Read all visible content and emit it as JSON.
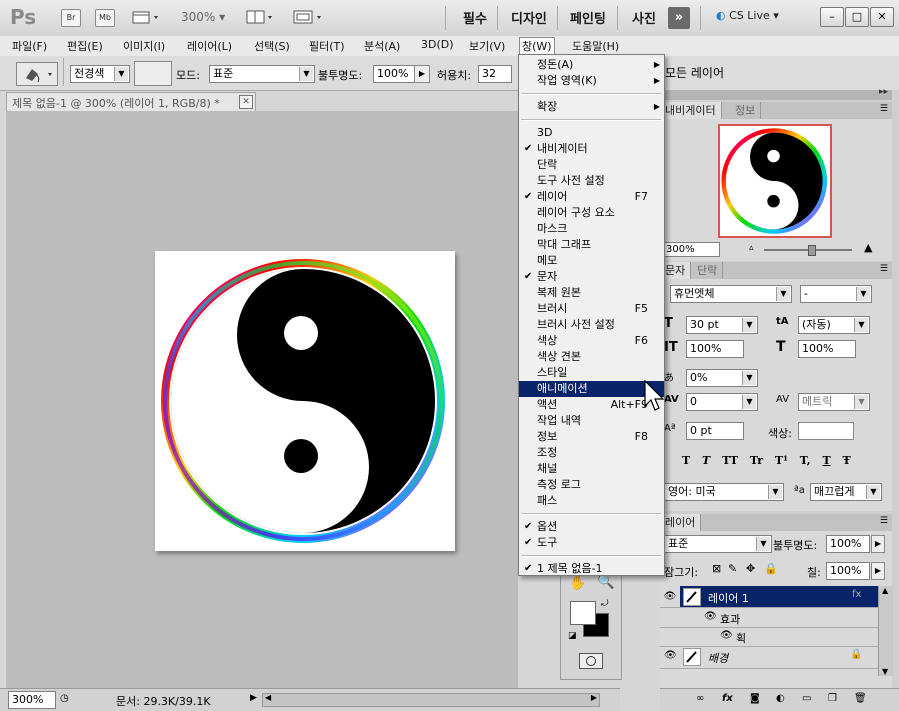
{
  "app": {
    "logo": "Ps",
    "bridge": "Br",
    "mini_bridge": "Mb",
    "zoom_label": "300%",
    "workspaces": [
      "필수",
      "디자인",
      "페인팅",
      "사진"
    ],
    "cs_live": "CS Live"
  },
  "menubar": [
    "파일(F)",
    "편집(E)",
    "이미지(I)",
    "레이어(L)",
    "선택(S)",
    "필터(T)",
    "분석(A)",
    "3D(D)",
    "보기(V)",
    "창(W)",
    "도움말(H)"
  ],
  "options": {
    "fill_source": "전경색",
    "mode_label": "모드:",
    "mode_value": "표준",
    "opacity_label": "불투명도:",
    "opacity_value": "100%",
    "tolerance_label": "허용치:",
    "tolerance_value": "32",
    "all_layers": "모든 레이어"
  },
  "document": {
    "tab_title": "제목 없음-1 @ 300% (레이어 1, RGB/8) *"
  },
  "status": {
    "zoom": "300%",
    "doc_info": "문서: 29.3K/39.1K"
  },
  "window_menu": {
    "items": [
      {
        "label": "정돈(A)",
        "submenu": true
      },
      {
        "label": "작업 영역(K)",
        "submenu": true
      },
      {
        "sep": true
      },
      {
        "label": "확장",
        "submenu": true
      },
      {
        "sep": true
      },
      {
        "label": "3D"
      },
      {
        "label": "내비게이터",
        "checked": true
      },
      {
        "label": "단락"
      },
      {
        "label": "도구 사전 설정"
      },
      {
        "label": "레이어",
        "checked": true,
        "shortcut": "F7"
      },
      {
        "label": "레이어 구성 요소"
      },
      {
        "label": "마스크"
      },
      {
        "label": "막대 그래프"
      },
      {
        "label": "메모"
      },
      {
        "label": "문자",
        "checked": true
      },
      {
        "label": "복제 원본"
      },
      {
        "label": "브러시",
        "shortcut": "F5"
      },
      {
        "label": "브러시 사전 설정"
      },
      {
        "label": "색상",
        "shortcut": "F6"
      },
      {
        "label": "색상 견본"
      },
      {
        "label": "스타일"
      },
      {
        "label": "애니메이션",
        "highlight": true
      },
      {
        "label": "액션",
        "shortcut": "Alt+F9"
      },
      {
        "label": "작업 내역"
      },
      {
        "label": "정보",
        "shortcut": "F8"
      },
      {
        "label": "조정"
      },
      {
        "label": "채널"
      },
      {
        "label": "측정 로그"
      },
      {
        "label": "패스"
      },
      {
        "sep": true
      },
      {
        "label": "옵션",
        "checked": true
      },
      {
        "label": "도구",
        "checked": true
      },
      {
        "sep": true
      },
      {
        "label": "1 제목 없음-1",
        "checked": true
      }
    ]
  },
  "navigator": {
    "tabs": [
      "내비게이터",
      "정보"
    ],
    "zoom": "300%"
  },
  "character": {
    "tabs": [
      "문자",
      "단락"
    ],
    "font_family": "휴먼엣체",
    "font_style": "-",
    "size": "30 pt",
    "leading": "(자동)",
    "vscale": "100%",
    "hscale": "100%",
    "tracking_pct": "0%",
    "tracking": "0",
    "kerning": "메트릭",
    "baseline": "0 pt",
    "color_label": "색상:",
    "language": "영어: 미국",
    "aa_label": "ªa",
    "antialias": "매끄럽게",
    "style_buttons": [
      "T",
      "T",
      "TT",
      "Tr",
      "T¹",
      "T,",
      "T",
      "Ŧ"
    ]
  },
  "layers": {
    "tab": "레이어",
    "blend": "표준",
    "opacity_label": "불투명도:",
    "opacity": "100%",
    "lock_label": "잠그기:",
    "fill_label": "칠:",
    "fill": "100%",
    "rows": [
      {
        "name": "레이어 1",
        "selected": true
      },
      {
        "name": "효과"
      },
      {
        "name": "획"
      },
      {
        "name": "배경",
        "locked": true
      }
    ]
  },
  "colors": {
    "menu_highlight": "#0a246a",
    "layer_selected": "#0a246a",
    "navigator_frame": "#d9534f"
  }
}
